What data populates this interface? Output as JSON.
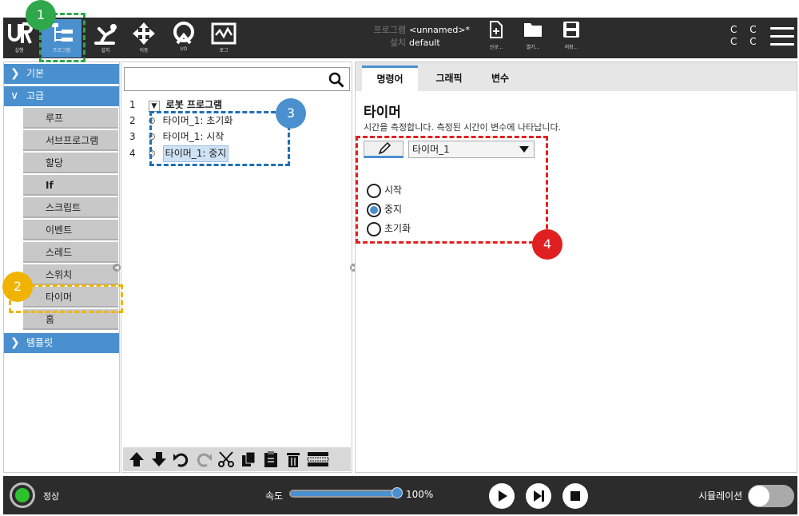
{
  "header": {
    "nav": [
      {
        "label": "실행",
        "icon": "ur-logo-icon"
      },
      {
        "label": "프로그램",
        "icon": "program-tree-icon"
      },
      {
        "label": "설치",
        "icon": "robot-arm-icon"
      },
      {
        "label": "이동",
        "icon": "move-arrows-icon"
      },
      {
        "label": "I/O",
        "icon": "io-icon"
      },
      {
        "label": "로그",
        "icon": "log-icon"
      }
    ],
    "program_key": "프로그램",
    "program_value": "<unnamed>*",
    "install_key": "설치",
    "install_value": "default",
    "file_buttons": [
      {
        "label": "신규...",
        "icon": "new-file-icon"
      },
      {
        "label": "열기...",
        "icon": "open-folder-icon"
      },
      {
        "label": "저장...",
        "icon": "save-icon"
      }
    ],
    "cc_line1": "C C",
    "cc_line2": "C C"
  },
  "left": {
    "cat_basic": "기본",
    "cat_advanced": "고급",
    "items": [
      "루프",
      "서브프로그램",
      "할당",
      "If",
      "스크립트",
      "이벤트",
      "스레드",
      "스위치",
      "타이머",
      "홈"
    ],
    "cat_templates": "템플릿"
  },
  "tree": {
    "rows": [
      {
        "num": "1",
        "text": "로봇 프로그램"
      },
      {
        "num": "2",
        "text": "타이머_1: 초기화"
      },
      {
        "num": "3",
        "text": "타이머_1: 시작"
      },
      {
        "num": "4",
        "text": "타이머_1: 중지"
      }
    ]
  },
  "right": {
    "tabs": [
      "명령어",
      "그래픽",
      "변수"
    ],
    "title": "타이머",
    "description": "시간을 측정합니다. 측정된 시간이 변수에 나타납니다.",
    "variable": "타이머_1",
    "options": [
      "시작",
      "중지",
      "초기화"
    ],
    "selected_option": "중지"
  },
  "annotations": [
    "1",
    "2",
    "3",
    "4"
  ],
  "footer": {
    "status": "정상",
    "speed_label": "속도",
    "speed_value": "100%",
    "speed_fraction": 1.0,
    "simulation_label": "시뮬레이션"
  },
  "colors": {
    "accent": "#4a90cf",
    "header_bg": "#2c2c2c",
    "anno_green": "#2ea84a",
    "anno_yellow": "#f0b400",
    "anno_blue": "#1f6fb5",
    "anno_red": "#e02020"
  }
}
